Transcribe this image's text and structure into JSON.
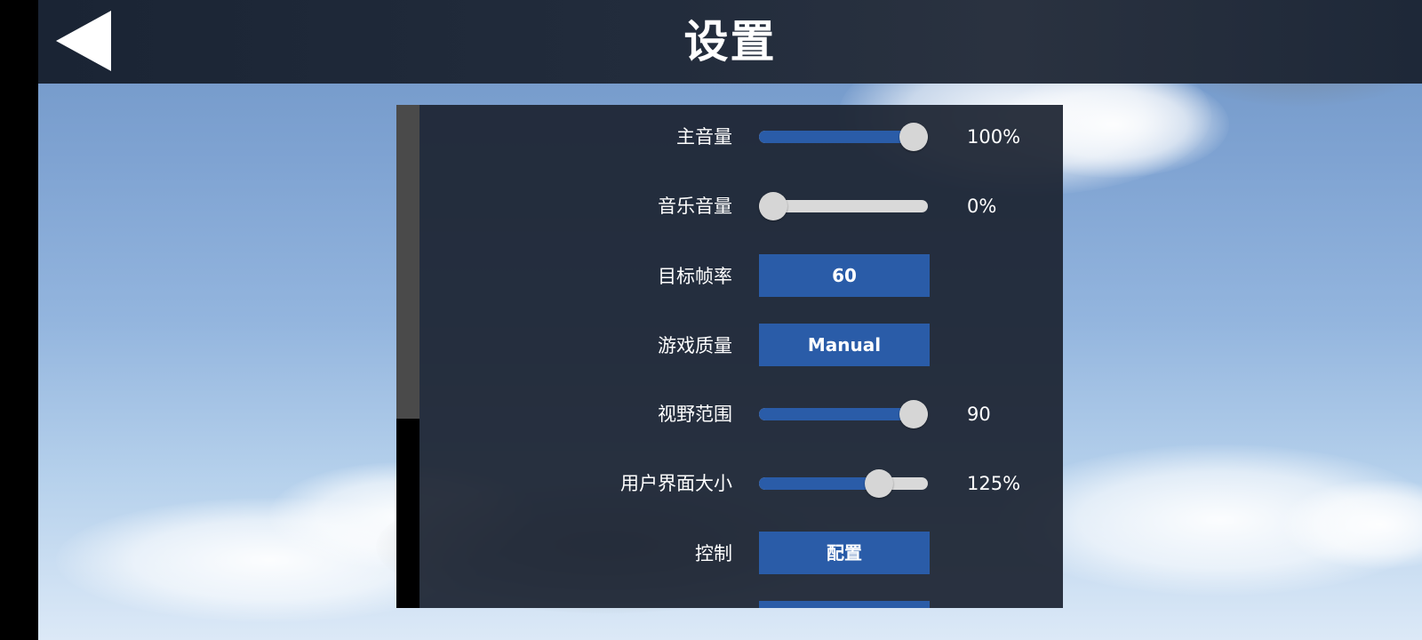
{
  "header": {
    "title": "设置"
  },
  "settings": {
    "master_volume": {
      "label": "主音量",
      "value_text": "100%",
      "level": 1.0
    },
    "music_volume": {
      "label": "音乐音量",
      "value_text": "0%",
      "level": 0.0
    },
    "target_framerate": {
      "label": "目标帧率",
      "button_label": "60"
    },
    "game_quality": {
      "label": "游戏质量",
      "button_label": "Manual"
    },
    "field_of_view": {
      "label": "视野范围",
      "value_text": "90",
      "level": 1.0
    },
    "ui_scale": {
      "label": "用户界面大小",
      "value_text": "125%",
      "level": 0.75
    },
    "controls": {
      "label": "控制",
      "button_label": "配置"
    }
  },
  "colors": {
    "accent_blue": "#2a5ca8",
    "panel_bg": "#1c2432",
    "track_light": "#d9d9d9",
    "knob": "#d6d6d6"
  },
  "icons": {
    "back": "back-arrow-icon"
  }
}
